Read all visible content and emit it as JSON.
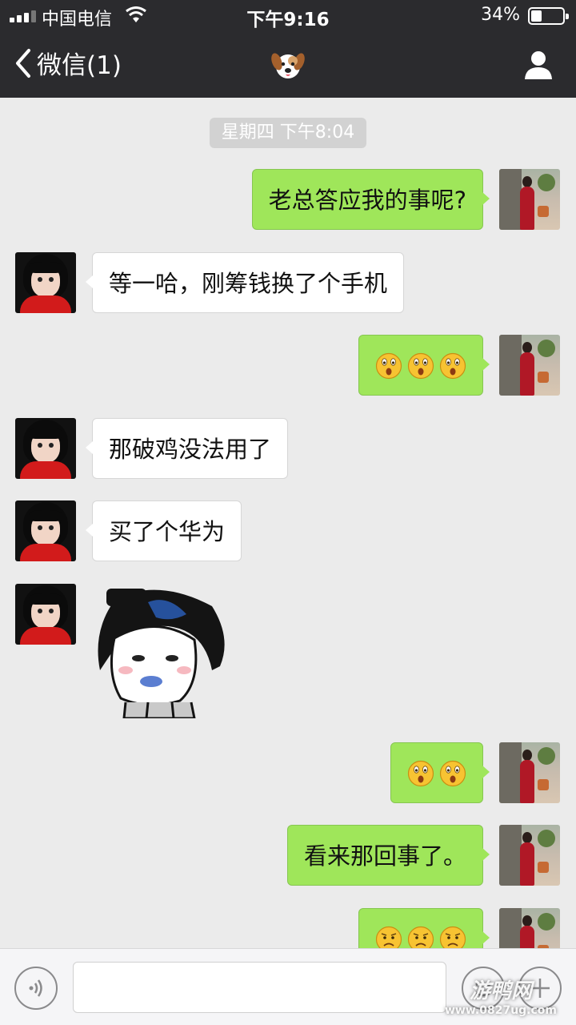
{
  "status_bar": {
    "carrier": "中国电信",
    "time": "下午9:16",
    "battery": "34%"
  },
  "nav": {
    "back_label": "微信(1)",
    "title_icon": "dog-face-emoji-icon",
    "right_icon": "person-icon"
  },
  "chat": {
    "timestamp": "星期四 下午8:04",
    "messages": [
      {
        "side": "right",
        "text": "老总答应我的事呢?"
      },
      {
        "side": "left",
        "text": "等一哈，刚筹钱换了个手机"
      },
      {
        "side": "right",
        "emoji": [
          "surprised-face-emoji-icon",
          "surprised-face-emoji-icon",
          "surprised-face-emoji-icon"
        ]
      },
      {
        "side": "left",
        "text": "那破鸡没法用了"
      },
      {
        "side": "left",
        "text": "买了个华为"
      },
      {
        "side": "left",
        "sticker": "meme-face-sticker"
      },
      {
        "side": "right",
        "emoji": [
          "surprised-face-emoji-icon",
          "surprised-face-emoji-icon"
        ]
      },
      {
        "side": "right",
        "text": "看来那回事了。"
      },
      {
        "side": "right",
        "emoji": [
          "frowning-face-emoji-icon",
          "frowning-face-emoji-icon",
          "frowning-face-emoji-icon"
        ]
      }
    ]
  },
  "input_bar": {
    "voice_icon": "voice-icon",
    "smiley_icon": "smiley-icon",
    "plus_icon": "plus-icon"
  },
  "watermark": {
    "line1": "游鸭网",
    "line2": "www.0827ug.com"
  },
  "colors": {
    "header_bg": "#2b2b2e",
    "chat_bg": "#ebebeb",
    "sent_bubble": "#9fe65a",
    "received_bubble": "#ffffff"
  }
}
